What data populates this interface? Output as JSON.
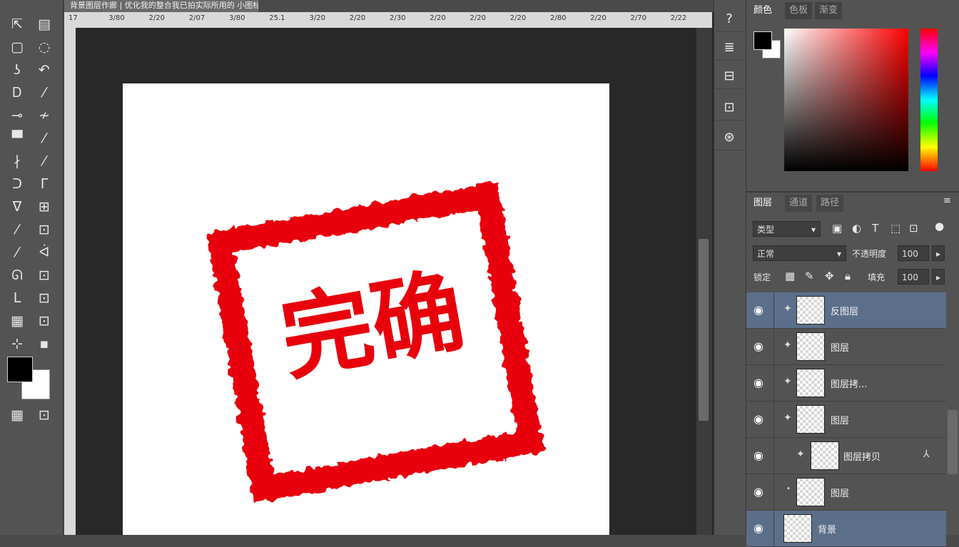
{
  "document": {
    "tab_title": "背景图层作廊 | 优化我的整合我已拍实际所用的 小图标",
    "ruler_top_ticks": [
      "17",
      "3/80",
      "2/20",
      "2/07",
      "3/80",
      "25.1",
      "3/20",
      "2/20",
      "2/30",
      "2/20",
      "2/20",
      "2/20",
      "2/80",
      "2/20",
      "2/70",
      "2/22"
    ]
  },
  "toolbar": {
    "tools": [
      "⇱",
      "▤",
      "▢",
      "◌",
      "ʖ",
      "↶",
      "Ꭰ",
      "⁄",
      "⊸",
      "≁",
      "▀",
      "⁄",
      "∤",
      "⁄",
      "ᑐ",
      "ᒥ",
      "ᐁ",
      "⊞",
      "⁄",
      "⊡",
      "⁄",
      "ᐋ",
      "ᘏ",
      "⊡",
      "ᒪ",
      "⊡",
      "▦",
      "⊡",
      "⊹",
      "▪"
    ],
    "bottom_left": "▦",
    "bottom_right": "⊡"
  },
  "right_strip": {
    "icons": [
      "?",
      "≣",
      "⊟",
      "⊡",
      "⊛"
    ]
  },
  "color_panel": {
    "tabs": [
      "颜色",
      "色板",
      "渐变"
    ]
  },
  "layers_panel": {
    "tabs": [
      "图层",
      "通道",
      "路径"
    ],
    "kind_filter": "类型",
    "blend_mode": "正常",
    "opacity_label": "不透明度",
    "opacity_value": "100",
    "lock_label": "锁定",
    "fill_label": "填充",
    "fill_value": "100",
    "layers": [
      {
        "name": "反图层",
        "selected": true,
        "linked": false
      },
      {
        "name": "图层",
        "selected": false,
        "linked": false
      },
      {
        "name": "图层拷...",
        "selected": false,
        "linked": false
      },
      {
        "name": "图层",
        "selected": false,
        "linked": false
      },
      {
        "name": "图层拷贝",
        "selected": false,
        "linked": true
      },
      {
        "name": "图层",
        "selected": false,
        "linked": false
      },
      {
        "name": "背景",
        "selected": true,
        "linked": false
      }
    ]
  },
  "canvas": {
    "stamp_text": "完确",
    "stamp_color": "#e8000b"
  },
  "colors": {
    "foreground": "#000000",
    "background": "#ffffff",
    "selection": "#5c6f8a"
  }
}
